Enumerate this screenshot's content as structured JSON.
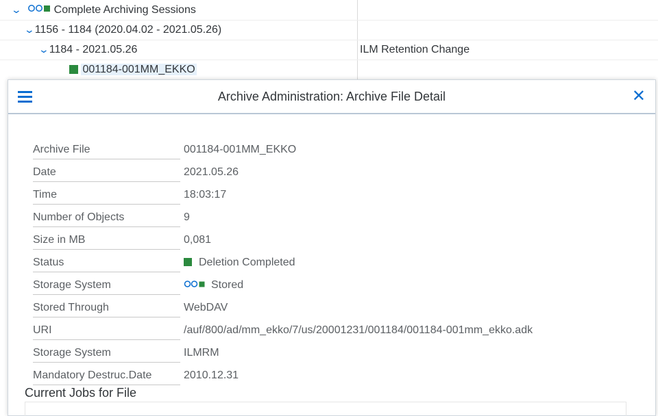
{
  "tree": {
    "rows": [
      {
        "label": "Complete Archiving Sessions",
        "right": ""
      },
      {
        "label": "1156 - 1184 (2020.04.02 - 2021.05.26)",
        "right": ""
      },
      {
        "label": "1184 - 2021.05.26",
        "right": "ILM Retention Change"
      },
      {
        "label": "001184-001MM_EKKO",
        "right": ""
      }
    ]
  },
  "dialog": {
    "title": "Archive Administration: Archive File Detail",
    "fields": [
      {
        "label": "Archive File",
        "value": "001184-001MM_EKKO"
      },
      {
        "label": "Date",
        "value": "2021.05.26"
      },
      {
        "label": "Time",
        "value": "18:03:17"
      },
      {
        "label": "Number of Objects",
        "value": "9"
      },
      {
        "label": "Size in MB",
        "value": "0,081"
      },
      {
        "label": "Status",
        "value": "Deletion Completed"
      },
      {
        "label": "Storage System",
        "value": "Stored"
      },
      {
        "label": "Stored Through",
        "value": "WebDAV"
      },
      {
        "label": "URI",
        "value": "/auf/800/ad/mm_ekko/7/us/20001231/001184/001184-001mm_ekko.adk"
      },
      {
        "label": "Storage System",
        "value": "ILMRM"
      },
      {
        "label": "Mandatory Destruc.Date",
        "value": "2010.12.31"
      }
    ],
    "section_title": "Current Jobs for File"
  },
  "colors": {
    "accent": "#0a6ed1",
    "status_green": "#2b8a3e"
  },
  "icons": {
    "expand": "chevron-down-icon",
    "storage": "storage-status-icon",
    "status": "status-square-icon",
    "menu": "menu-icon",
    "close": "close-icon"
  }
}
